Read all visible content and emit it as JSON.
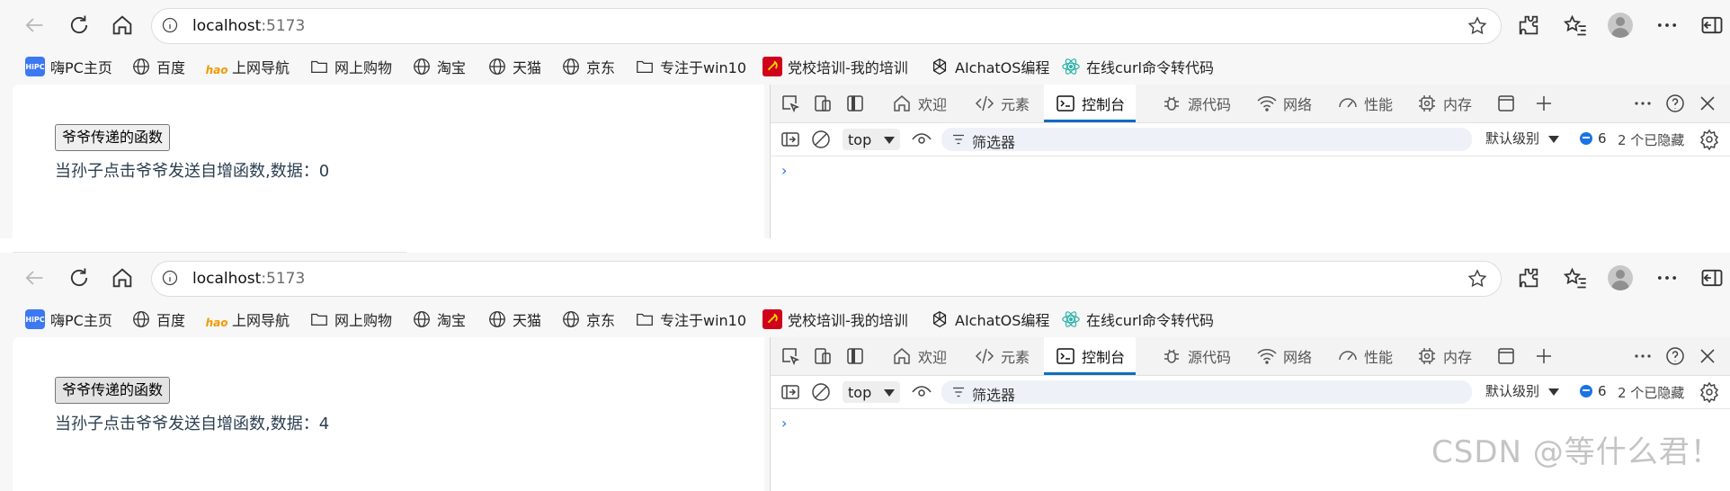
{
  "browser": {
    "url_host": "localhost",
    "url_port": ":5173"
  },
  "bookmarks": [
    {
      "label": "嗨PC主页",
      "icon": "hipc-logo-icon"
    },
    {
      "label": "百度",
      "icon": "globe-icon"
    },
    {
      "label": "上网导航",
      "icon": "hao-logo-icon"
    },
    {
      "label": "网上购物",
      "icon": "folder-icon"
    },
    {
      "label": "淘宝",
      "icon": "globe-icon"
    },
    {
      "label": "天猫",
      "icon": "globe-icon"
    },
    {
      "label": "京东",
      "icon": "globe-icon"
    },
    {
      "label": "专注于win10",
      "icon": "folder-icon"
    },
    {
      "label": "党校培训-我的培训",
      "icon": "party-emblem-icon"
    },
    {
      "label": "AIchatOS编程",
      "icon": "openai-logo-icon"
    },
    {
      "label": "在线curl命令转代码",
      "icon": "react-logo-icon"
    }
  ],
  "bookmark_logo_text": "HiPC",
  "bookmark_hao_text": "hao",
  "page": {
    "button_label": "爷爷传递的函数",
    "status_prefix": "当孙子点击爷爷发送自增函数,数据：",
    "count_before": "0",
    "count_after": "4"
  },
  "devtools": {
    "tabs": [
      {
        "label": "欢迎",
        "icon": "home-icon"
      },
      {
        "label": "元素",
        "icon": "code-icon"
      },
      {
        "label": "控制台",
        "icon": "console-icon",
        "active": true
      },
      {
        "label": "源代码",
        "icon": "bug-icon"
      },
      {
        "label": "网络",
        "icon": "wifi-icon"
      },
      {
        "label": "性能",
        "icon": "gauge-icon"
      },
      {
        "label": "内存",
        "icon": "chip-icon"
      }
    ],
    "context": "top",
    "filter_placeholder": "筛选器",
    "level": "默认级别",
    "message_count": "6",
    "hidden": "2 个已隐藏",
    "prompt": "›"
  },
  "colors": {
    "accent": "#0f6cbd",
    "text": "#2c3e50"
  },
  "watermark": "CSDN @等什么君！"
}
